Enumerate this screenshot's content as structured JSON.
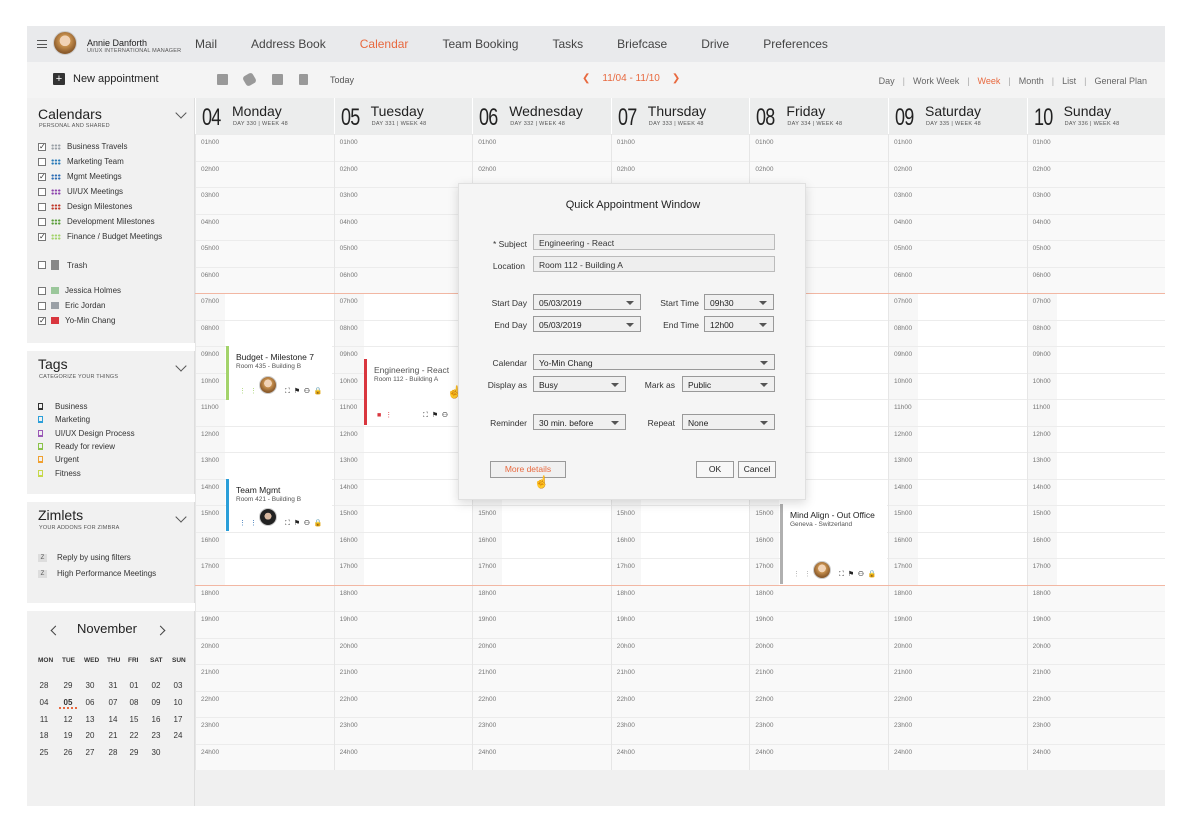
{
  "user": {
    "name": "Annie Danforth",
    "role": "UI/UX INTERNATIONAL MANAGER"
  },
  "nav": [
    "Mail",
    "Address Book",
    "Calendar",
    "Team Booking",
    "Tasks",
    "Briefcase",
    "Drive",
    "Preferences"
  ],
  "nav_active": "Calendar",
  "toolbar": {
    "new_appointment": "New appointment",
    "today": "Today",
    "week_range": "11/04 - 11/10",
    "views": [
      "Day",
      "Work Week",
      "Week",
      "Month",
      "List",
      "General Plan"
    ],
    "active_view": "Week"
  },
  "sidebar": {
    "calendars_title": "Calendars",
    "calendars_sub": "PERSONAL AND SHARED",
    "calendars": [
      {
        "label": "Business Travels",
        "checked": true,
        "color": "#9aa0a6"
      },
      {
        "label": "Marketing Team",
        "checked": false,
        "color": "#2b7bb9"
      },
      {
        "label": "Mgmt Meetings",
        "checked": true,
        "color": "#2d6db4"
      },
      {
        "label": "UI/UX Meetings",
        "checked": false,
        "color": "#8e44ad"
      },
      {
        "label": "Design Milestones",
        "checked": false,
        "color": "#c0392b"
      },
      {
        "label": "Development Milestones",
        "checked": false,
        "color": "#5a9e3a"
      },
      {
        "label": "Finance / Budget Meetings",
        "checked": true,
        "color": "#a3d36b"
      }
    ],
    "trash": "Trash",
    "people": [
      {
        "label": "Jessica Holmes",
        "checked": false,
        "color": "#9bc79b"
      },
      {
        "label": "Eric Jordan",
        "checked": false,
        "color": "#9aa0a6"
      },
      {
        "label": "Yo-Min Chang",
        "checked": true,
        "color": "#d9363e"
      }
    ],
    "tags_title": "Tags",
    "tags_sub": "CATEGORIZE YOUR THINGS",
    "tags": [
      {
        "label": "Business",
        "color": "#333333"
      },
      {
        "label": "Marketing",
        "color": "#2b9fd9"
      },
      {
        "label": "UI/UX Design Process",
        "color": "#9b59b6"
      },
      {
        "label": "Ready for review",
        "color": "#8bc34a"
      },
      {
        "label": "Urgent",
        "color": "#f0a030"
      },
      {
        "label": "Fitness",
        "color": "#c6d84a"
      }
    ],
    "zimlets_title": "Zimlets",
    "zimlets_sub": "YOUR ADDONS FOR ZIMBRA",
    "zimlets": [
      "Reply by using filters",
      "High Performance Meetings"
    ]
  },
  "mini_calendar": {
    "month": "November",
    "dow": [
      "MON",
      "TUE",
      "WED",
      "THU",
      "FRI",
      "SAT",
      "SUN"
    ],
    "weeks": [
      [
        "28",
        "29",
        "30",
        "31",
        "01",
        "02",
        "03"
      ],
      [
        "04",
        "05",
        "06",
        "07",
        "08",
        "09",
        "10"
      ],
      [
        "11",
        "12",
        "13",
        "14",
        "15",
        "16",
        "17"
      ],
      [
        "18",
        "19",
        "20",
        "21",
        "22",
        "23",
        "24"
      ],
      [
        "25",
        "26",
        "27",
        "28",
        "29",
        "30",
        ""
      ]
    ],
    "today": "05"
  },
  "days": [
    {
      "num": "04",
      "name": "Monday",
      "sub": "DAY 330  |  WEEK 48"
    },
    {
      "num": "05",
      "name": "Tuesday",
      "sub": "DAY 331  |  WEEK 48"
    },
    {
      "num": "06",
      "name": "Wednesday",
      "sub": "DAY 332  |  WEEK 48"
    },
    {
      "num": "07",
      "name": "Thursday",
      "sub": "DAY 333  |  WEEK 48"
    },
    {
      "num": "08",
      "name": "Friday",
      "sub": "DAY 334  |  WEEK 48"
    },
    {
      "num": "09",
      "name": "Saturday",
      "sub": "DAY 335  |  WEEK 48"
    },
    {
      "num": "10",
      "name": "Sunday",
      "sub": "DAY 336  |  WEEK 48"
    }
  ],
  "hours": [
    "01h00",
    "02h00",
    "03h00",
    "04h00",
    "05h00",
    "06h00",
    "07h00",
    "08h00",
    "09h00",
    "10h00",
    "11h00",
    "12h00",
    "13h00",
    "14h00",
    "15h00",
    "16h00",
    "17h00",
    "18h00",
    "19h00",
    "20h00",
    "21h00",
    "22h00",
    "23h00",
    "24h00"
  ],
  "events": {
    "budget": {
      "title": "Budget - Milestone 7",
      "location": "Room 435 - Building B",
      "color": "#a3d36b"
    },
    "team": {
      "title": "Team Mgmt",
      "location": "Room 421 - Building B",
      "color": "#2b9fd9"
    },
    "eng": {
      "title": "Engineering - React",
      "location": "Room 112 - Building A",
      "color": "#d9363e"
    },
    "mind": {
      "title": "Mind Align - Out Office",
      "location": "Geneva - Switzerland",
      "color": "#9aa0a6"
    }
  },
  "modal": {
    "title": "Quick Appointment Window",
    "subject_label": "* Subject",
    "subject_value": "Engineering - React",
    "location_label": "Location",
    "location_value": "Room 112 - Building A",
    "start_day_label": "Start Day",
    "start_day": "05/03/2019",
    "end_day_label": "End Day",
    "end_day": "05/03/2019",
    "start_time_label": "Start Time",
    "start_time": "09h30",
    "end_time_label": "End Time",
    "end_time": "12h00",
    "calendar_label": "Calendar",
    "calendar": "Yo-Min Chang",
    "display_label": "Display as",
    "display": "Busy",
    "mark_label": "Mark as",
    "mark": "Public",
    "reminder_label": "Reminder",
    "reminder": "30 min. before",
    "repeat_label": "Repeat",
    "repeat": "None",
    "more_details": "More details",
    "ok": "OK",
    "cancel": "Cancel"
  }
}
